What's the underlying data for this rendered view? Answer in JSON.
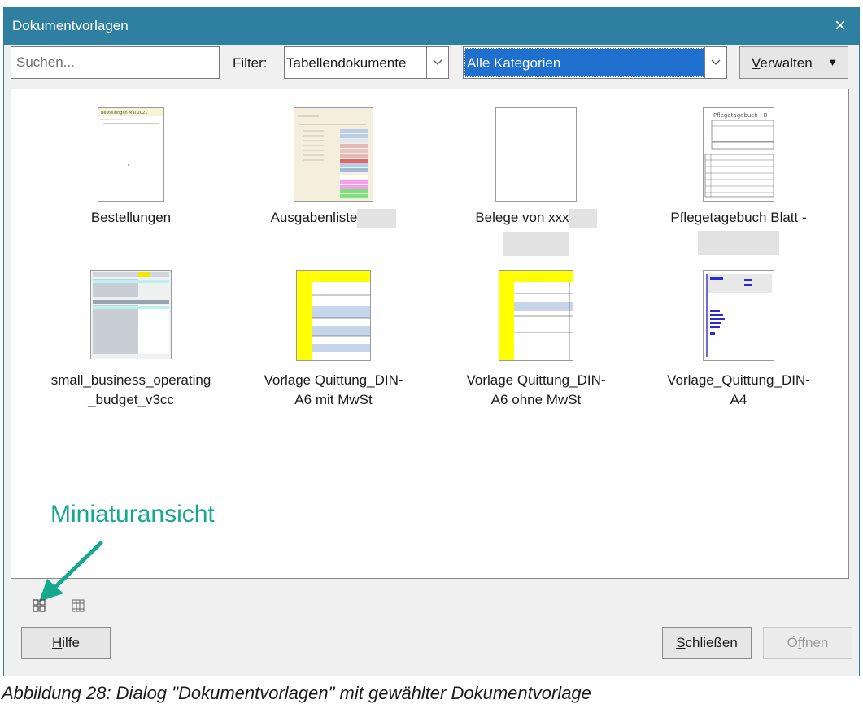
{
  "window": {
    "title": "Dokumentvorlagen",
    "close_icon": "×"
  },
  "search": {
    "placeholder": "Suchen..."
  },
  "filter": {
    "label": "Filter:",
    "type_value": "Tabellendokumente",
    "category_value": "Alle Kategorien",
    "dropdown_icon": "chevron-down-icon"
  },
  "manage": {
    "label_underlined": "V",
    "label_rest": "erwalten",
    "caret": "▼"
  },
  "templates": [
    {
      "label": "Bestellungen"
    },
    {
      "label": "Ausgabenliste"
    },
    {
      "label": "Belege von xxx"
    },
    {
      "label": "Pflegetagebuch Blatt -"
    },
    {
      "label": "small_business_operating",
      "label2": "_budget_v3cc"
    },
    {
      "label": "Vorlage Quittung_DIN-",
      "label2": "A6 mit MwSt"
    },
    {
      "label": "Vorlage Quittung_DIN-",
      "label2": "A6 ohne MwSt"
    },
    {
      "label": "Vorlage_Quittung_DIN-",
      "label2": "A4"
    }
  ],
  "annotation": {
    "text": "Miniaturansicht",
    "color": "#14a88e"
  },
  "view_buttons": {
    "thumbnail": "thumbnail-view-icon",
    "list": "list-view-icon"
  },
  "buttons": {
    "help_u": "H",
    "help_rest": "ilfe",
    "close_u": "S",
    "close_rest": "chließen",
    "open_pre": "Ö",
    "open_u": "f",
    "open_rest": "fnen"
  },
  "caption": "Abbildung 28: Dialog \"Dokumentvorlagen\" mit gewählter Dokumentvorlage",
  "colors": {
    "titlebar": "#2e7fa0",
    "selection": "#1f6fcf",
    "accent": "#14a88e"
  }
}
